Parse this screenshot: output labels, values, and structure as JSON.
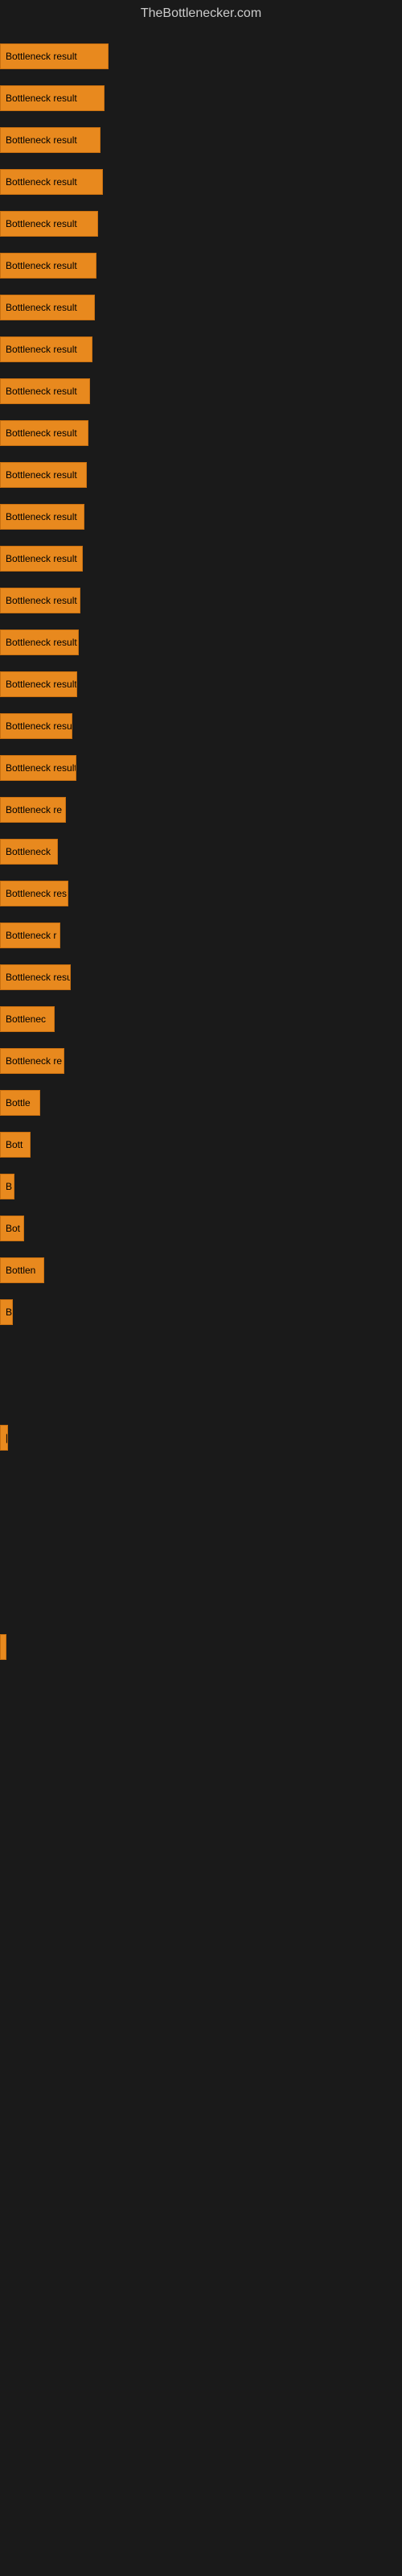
{
  "site_title": "TheBottlenecker.com",
  "bars": [
    {
      "label": "Bottleneck result",
      "width": 135
    },
    {
      "label": "Bottleneck result",
      "width": 130
    },
    {
      "label": "Bottleneck result",
      "width": 125
    },
    {
      "label": "Bottleneck result",
      "width": 128
    },
    {
      "label": "Bottleneck result",
      "width": 122
    },
    {
      "label": "Bottleneck result",
      "width": 120
    },
    {
      "label": "Bottleneck result",
      "width": 118
    },
    {
      "label": "Bottleneck result",
      "width": 115
    },
    {
      "label": "Bottleneck result",
      "width": 112
    },
    {
      "label": "Bottleneck result",
      "width": 110
    },
    {
      "label": "Bottleneck result",
      "width": 108
    },
    {
      "label": "Bottleneck result",
      "width": 105
    },
    {
      "label": "Bottleneck result",
      "width": 103
    },
    {
      "label": "Bottleneck result",
      "width": 100
    },
    {
      "label": "Bottleneck result",
      "width": 98
    },
    {
      "label": "Bottleneck result",
      "width": 96
    },
    {
      "label": "Bottleneck resu",
      "width": 90
    },
    {
      "label": "Bottleneck result",
      "width": 95
    },
    {
      "label": "Bottleneck re",
      "width": 82
    },
    {
      "label": "Bottleneck",
      "width": 72
    },
    {
      "label": "Bottleneck res",
      "width": 85
    },
    {
      "label": "Bottleneck r",
      "width": 75
    },
    {
      "label": "Bottleneck resu",
      "width": 88
    },
    {
      "label": "Bottlenec",
      "width": 68
    },
    {
      "label": "Bottleneck re",
      "width": 80
    },
    {
      "label": "Bottle",
      "width": 50
    },
    {
      "label": "Bott",
      "width": 38
    },
    {
      "label": "B",
      "width": 18
    },
    {
      "label": "Bot",
      "width": 30
    },
    {
      "label": "Bottlen",
      "width": 55
    },
    {
      "label": "B",
      "width": 16
    },
    {
      "label": "",
      "width": 0
    },
    {
      "label": "",
      "width": 0
    },
    {
      "label": "[",
      "width": 10
    },
    {
      "label": "",
      "width": 0
    },
    {
      "label": "",
      "width": 0
    },
    {
      "label": "",
      "width": 0
    },
    {
      "label": "",
      "width": 0
    },
    {
      "label": "",
      "width": 4
    }
  ]
}
